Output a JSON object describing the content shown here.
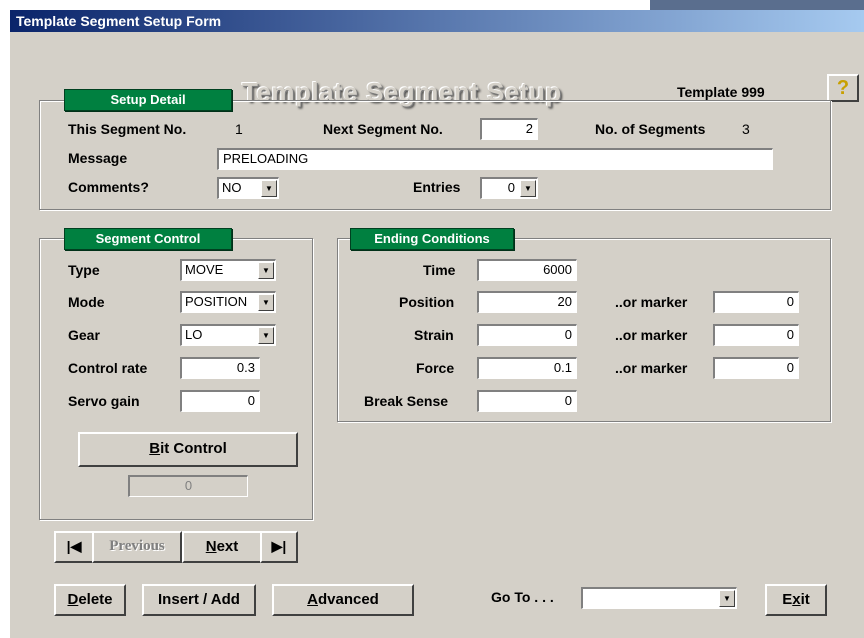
{
  "window_title": "Template Segment Setup Form",
  "header": {
    "title": "Template Segment Setup",
    "template_label": "Template 999",
    "help_icon": "question-mark-icon"
  },
  "setup_detail": {
    "tab": "Setup Detail",
    "this_segment_label": "This Segment No.",
    "this_segment_value": "1",
    "next_segment_label": "Next Segment No.",
    "next_segment_value": "2",
    "num_segments_label": "No. of Segments",
    "num_segments_value": "3",
    "message_label": "Message",
    "message_value": "PRELOADING",
    "comments_label": "Comments?",
    "comments_value": "NO",
    "entries_label": "Entries",
    "entries_value": "0"
  },
  "segment_control": {
    "tab": "Segment Control",
    "type_label": "Type",
    "type_value": "MOVE",
    "mode_label": "Mode",
    "mode_value": "POSITION",
    "gear_label": "Gear",
    "gear_value": "LO",
    "control_rate_label": "Control rate",
    "control_rate_value": "0.3",
    "servo_gain_label": "Servo gain",
    "servo_gain_value": "0",
    "bit_control_button_prefix": "B",
    "bit_control_button_rest": "it Control",
    "bit_value": "0"
  },
  "ending_conditions": {
    "tab": "Ending Conditions",
    "time_label": "Time",
    "time_value": "6000",
    "position_label": "Position",
    "position_value": "20",
    "position_marker_label": "..or marker",
    "position_marker_value": "0",
    "strain_label": "Strain",
    "strain_value": "0",
    "strain_marker_label": "..or marker",
    "strain_marker_value": "0",
    "force_label": "Force",
    "force_value": "0.1",
    "force_marker_label": "..or marker",
    "force_marker_value": "0",
    "break_sense_label": "Break Sense",
    "break_sense_value": "0"
  },
  "nav": {
    "first_icon": "first-record-icon",
    "previous_label": "Previous",
    "next_prefix": "N",
    "next_rest": "ext",
    "last_icon": "last-record-icon"
  },
  "footer": {
    "delete_prefix": "D",
    "delete_rest": "elete",
    "insert_label": "Insert / Add",
    "advanced_prefix": "A",
    "advanced_rest": "dvanced",
    "goto_label": "Go To . . .",
    "goto_value": "",
    "exit_prefix": "E",
    "exit_mid": "x",
    "exit_rest": "it"
  }
}
